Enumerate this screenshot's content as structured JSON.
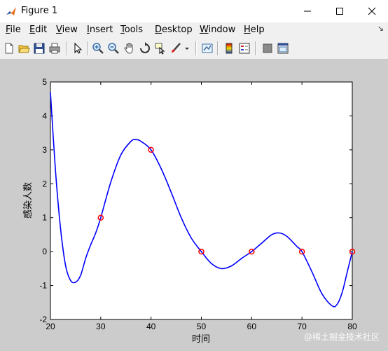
{
  "window": {
    "title": "Figure 1",
    "minimize_glyph": "—",
    "maximize_glyph": "☐",
    "close_glyph": "✕"
  },
  "menu": {
    "items": [
      {
        "first": "F",
        "rest": "ile"
      },
      {
        "first": "E",
        "rest": "dit"
      },
      {
        "first": "V",
        "rest": "iew"
      },
      {
        "first": "I",
        "rest": "nsert"
      },
      {
        "first": "T",
        "rest": "ools"
      },
      {
        "first": "D",
        "rest": "esktop"
      },
      {
        "first": "W",
        "rest": "indow"
      },
      {
        "first": "H",
        "rest": "elp"
      }
    ],
    "overflow_glyph": "↘"
  },
  "toolbar": {
    "icons": [
      "new-figure-icon",
      "open-file-icon",
      "save-icon",
      "print-icon",
      "pointer-icon",
      "zoom-in-icon",
      "zoom-out-icon",
      "pan-icon",
      "rotate-3d-icon",
      "data-cursor-icon",
      "brush-icon",
      "link-plot-icon",
      "insert-colorbar-icon",
      "insert-legend-icon",
      "hide-plot-tools-icon",
      "show-plot-tools-icon"
    ]
  },
  "chart_data": {
    "type": "line",
    "title": "",
    "xlabel": "时间",
    "ylabel": "感染人数",
    "xlim": [
      20,
      80
    ],
    "ylim": [
      -2,
      5
    ],
    "xticks": [
      20,
      30,
      40,
      50,
      60,
      70,
      80
    ],
    "yticks": [
      -2,
      -1,
      0,
      1,
      2,
      3,
      4,
      5
    ],
    "grid": false,
    "series": [
      {
        "kind": "curve",
        "color": "#0000ff",
        "x": [
          20,
          21,
          22,
          23,
          24,
          25,
          26,
          27,
          28,
          29,
          30,
          32,
          34,
          36,
          37,
          38,
          40,
          42,
          44,
          46,
          48,
          50,
          52,
          54,
          56,
          58,
          60,
          62,
          64,
          65.5,
          67,
          69,
          70,
          72,
          74,
          76,
          77,
          78,
          79,
          80
        ],
        "y": [
          4.7,
          2.4,
          0.7,
          -0.4,
          -0.85,
          -0.9,
          -0.7,
          -0.2,
          0.2,
          0.55,
          1.0,
          2.05,
          2.85,
          3.25,
          3.3,
          3.25,
          3.0,
          2.45,
          1.75,
          1.0,
          0.4,
          0.0,
          -0.35,
          -0.5,
          -0.42,
          -0.2,
          0.0,
          0.25,
          0.5,
          0.55,
          0.45,
          0.15,
          0.0,
          -0.6,
          -1.25,
          -1.6,
          -1.55,
          -1.2,
          -0.6,
          0.0
        ]
      },
      {
        "kind": "markers",
        "marker": "circle",
        "color": "#ff0000",
        "x": [
          30,
          40,
          50,
          60,
          70,
          80
        ],
        "y": [
          1,
          3,
          0,
          0,
          0,
          0
        ]
      }
    ]
  },
  "watermark": "@稀土掘金技术社区"
}
